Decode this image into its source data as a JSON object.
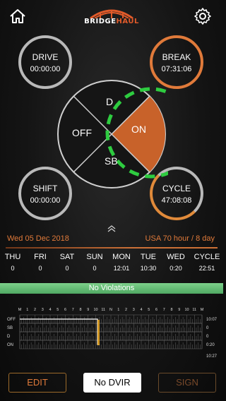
{
  "header": {
    "logo_text_bridge": "BRIDGE",
    "logo_text_haul": "HAUL",
    "home_icon": "home-icon",
    "settings_icon": "gear-icon"
  },
  "gauges": {
    "drive": {
      "label": "DRIVE",
      "value": "00:00:00"
    },
    "break": {
      "label": "BREAK",
      "value": "07:31:06"
    },
    "shift": {
      "label": "SHIFT",
      "value": "00:00:00"
    },
    "cycle": {
      "label": "CYCLE",
      "value": "47:08:08"
    }
  },
  "wheel": {
    "d": "D",
    "off": "OFF",
    "on": "ON",
    "sb": "SB",
    "selected": "ON"
  },
  "info": {
    "date": "Wed 05 Dec 2018",
    "ruleset": "USA 70 hour / 8 day"
  },
  "days": [
    {
      "day": "THU",
      "value": "0"
    },
    {
      "day": "FRI",
      "value": "0"
    },
    {
      "day": "SAT",
      "value": "0"
    },
    {
      "day": "SUN",
      "value": "0"
    },
    {
      "day": "MON",
      "value": "12:01"
    },
    {
      "day": "TUE",
      "value": "10:30"
    },
    {
      "day": "WED",
      "value": "0:20"
    }
  ],
  "cycle_total": {
    "label": "CYCLE",
    "value": "22:51"
  },
  "violations": "No Violations",
  "log": {
    "hours_top": [
      "M",
      "1",
      "2",
      "3",
      "4",
      "5",
      "6",
      "7",
      "8",
      "9",
      "10",
      "11",
      "N",
      "1",
      "2",
      "3",
      "4",
      "5",
      "6",
      "7",
      "8",
      "9",
      "10",
      "11",
      "M"
    ],
    "rows": [
      "OFF",
      "SB",
      "D",
      "ON"
    ],
    "totals": [
      "10:07",
      "0",
      "0",
      "0:20"
    ],
    "grand_total": "10:27"
  },
  "buttons": {
    "edit": "EDIT",
    "dvir": "No DVIR",
    "sign": "SIGN"
  },
  "colors": {
    "accent": "#e07a3a",
    "highlight": "#2ecc40",
    "violations": "#5fb870"
  }
}
